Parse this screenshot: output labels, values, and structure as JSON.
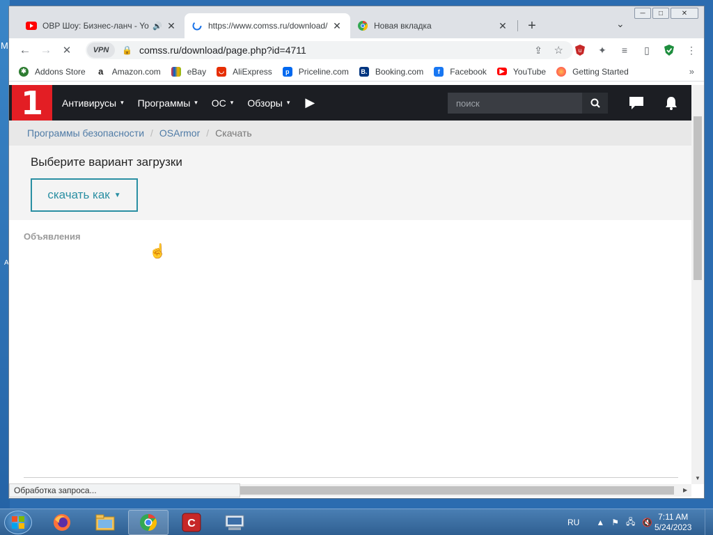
{
  "desktop": {
    "edge_text_1": "M",
    "edge_text_2": "A"
  },
  "window": {
    "minimize": "─",
    "maximize": "□",
    "close": "✕"
  },
  "tabs": [
    {
      "title": "OBP Шоу: Бизнес-ланч - Yo",
      "favicon": "youtube-icon",
      "audio": "🔊",
      "close": "✕"
    },
    {
      "title": "https://www.comss.ru/download/",
      "favicon": "loading-spinner-icon",
      "close": "✕"
    },
    {
      "title": "Новая вкладка",
      "favicon": "chrome-icon",
      "close": "✕"
    }
  ],
  "new_tab": "+",
  "tab_search": "⌄",
  "toolbar": {
    "back": "←",
    "forward": "→",
    "stop": "✕",
    "vpn": "VPN",
    "url": "comss.ru/download/page.php?id=4711",
    "share": "⇪",
    "star": "☆",
    "ext": [
      "◈",
      "✦",
      "≡",
      "▯",
      "✔",
      "⋮"
    ]
  },
  "bookmarks": [
    {
      "label": "Addons Store",
      "icon": "addons-icon",
      "color": "#2e7d32"
    },
    {
      "label": "Amazon.com",
      "icon": "amazon-icon",
      "color": "#222222"
    },
    {
      "label": "eBay",
      "icon": "ebay-icon",
      "color": "#e53238"
    },
    {
      "label": "AliExpress",
      "icon": "aliexpress-icon",
      "color": "#e62e04"
    },
    {
      "label": "Priceline.com",
      "icon": "priceline-icon",
      "color": "#0068ef"
    },
    {
      "label": "Booking.com",
      "icon": "booking-icon",
      "color": "#003580"
    },
    {
      "label": "Facebook",
      "icon": "facebook-icon",
      "color": "#1877f2"
    },
    {
      "label": "YouTube",
      "icon": "youtube-icon",
      "color": "#ff0000"
    },
    {
      "label": "Getting Started",
      "icon": "firefox-icon",
      "color": "#ff7139"
    }
  ],
  "bookmarks_more": "»",
  "site": {
    "logo": "1",
    "nav": [
      "Антивирусы",
      "Программы",
      "ОС",
      "Обзоры"
    ],
    "nav_caret": "▾",
    "search_placeholder": "поиск",
    "breadcrumbs": [
      "Программы безопасности",
      "OSArmor",
      "Скачать"
    ],
    "breadcrumb_divider": "/",
    "download_title": "Выберите вариант загрузки",
    "download_button": "скачать как",
    "ads_label": "Объявления"
  },
  "status_bar": "Обработка запроса...",
  "taskbar": {
    "apps": [
      "firefox-icon",
      "file-explorer-icon",
      "chrome-icon",
      "comodo-icon",
      "keyboard-app-icon"
    ],
    "language": "RU",
    "time": "7:11 AM",
    "date": "5/24/2023"
  },
  "colors": {
    "site_nav": "#1c1e23",
    "logo_red": "#e31e24",
    "download_accent": "#2a8fa3",
    "breadcrumb_link": "#4f7ba6"
  }
}
